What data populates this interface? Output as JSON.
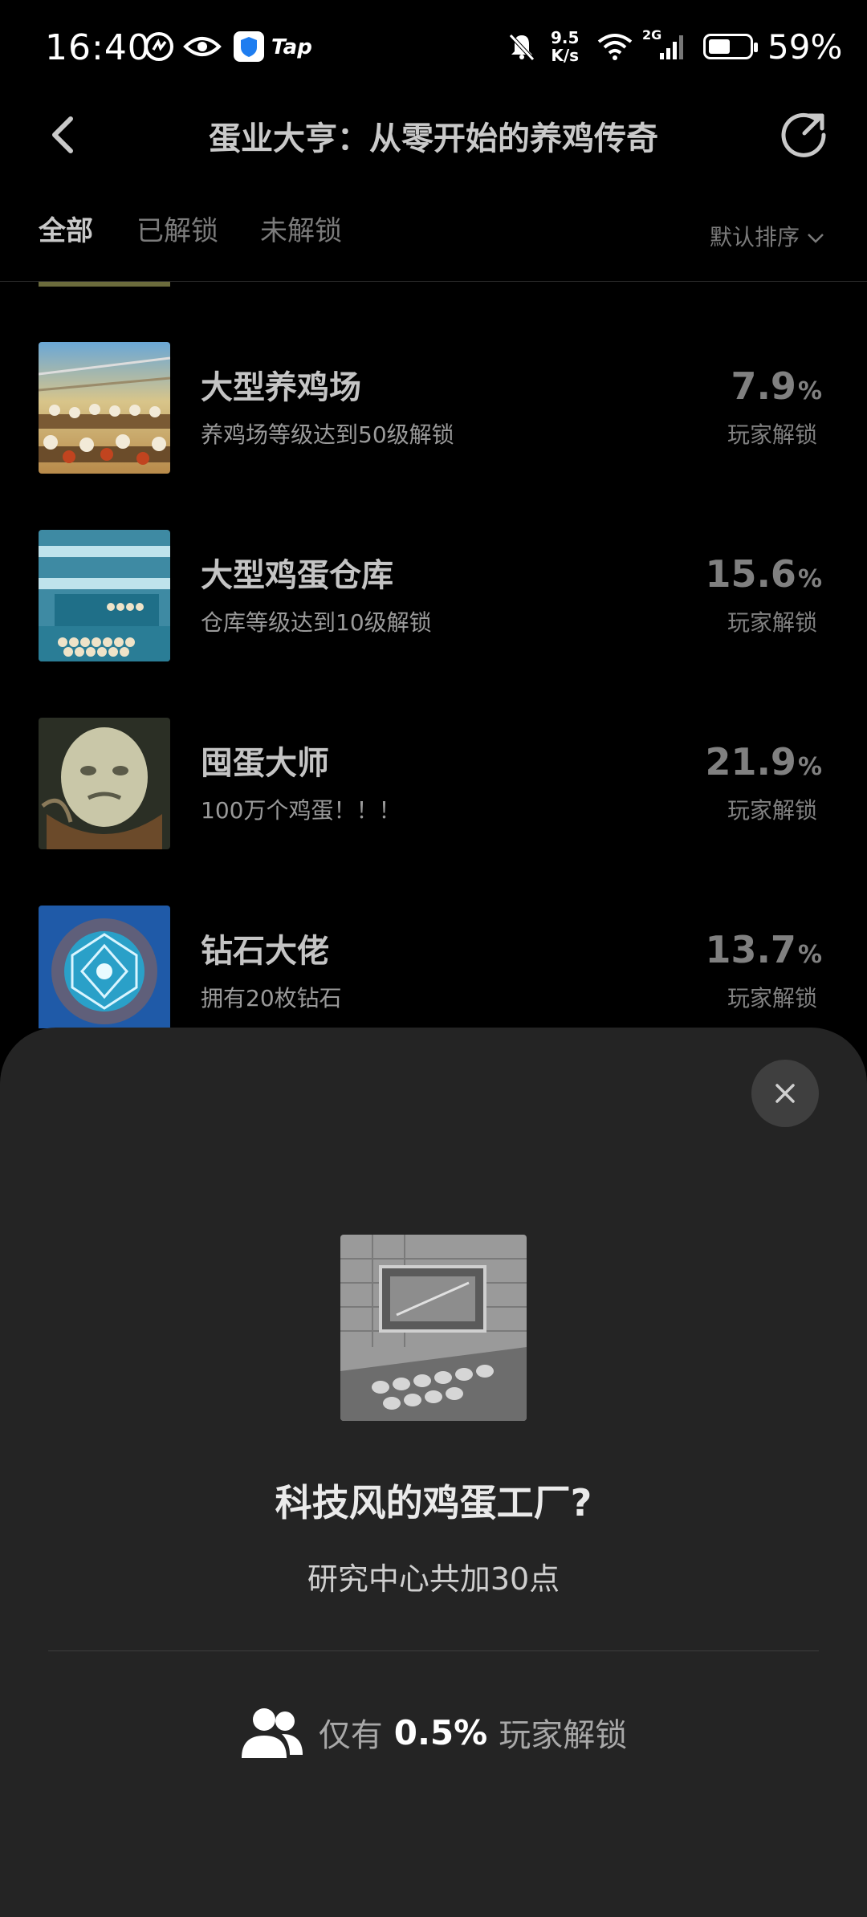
{
  "status_bar": {
    "time": "16:40",
    "tap_label": "Tap",
    "net_speed_value": "9.5",
    "net_speed_unit": "K/s",
    "signal_label": "2G",
    "battery": "59%"
  },
  "header": {
    "title": "蛋业大亨：从零开始的养鸡传奇",
    "back_icon": "chevron-left-icon",
    "refresh_icon": "refresh-icon"
  },
  "tabs": [
    {
      "label": "全部",
      "active": true
    },
    {
      "label": "已解锁",
      "active": false
    },
    {
      "label": "未解锁",
      "active": false
    }
  ],
  "sort": {
    "label": "默认排序",
    "icon": "chevron-down-icon"
  },
  "achievements": [
    {
      "title": "大型养鸡场",
      "desc": "养鸡场等级达到50级解锁",
      "pct": "7.9",
      "unit": "%",
      "sub": "玩家解锁"
    },
    {
      "title": "大型鸡蛋仓库",
      "desc": "仓库等级达到10级解锁",
      "pct": "15.6",
      "unit": "%",
      "sub": "玩家解锁"
    },
    {
      "title": "囤蛋大师",
      "desc": "100万个鸡蛋！！！",
      "pct": "21.9",
      "unit": "%",
      "sub": "玩家解锁"
    },
    {
      "title": "钻石大佬",
      "desc": "拥有20枚钻石",
      "pct": "13.7",
      "unit": "%",
      "sub": "玩家解锁"
    }
  ],
  "detail": {
    "title": "科技风的鸡蛋工厂?",
    "desc": "研究中心共加30点",
    "unlock_prefix": "仅有",
    "unlock_pct": "0.5%",
    "unlock_suffix": "玩家解锁",
    "close_icon": "close-icon",
    "people_icon": "people-icon"
  }
}
